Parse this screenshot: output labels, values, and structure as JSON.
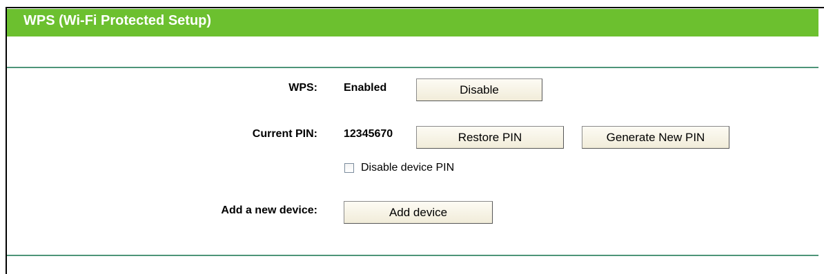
{
  "header": {
    "title": "WPS (Wi-Fi Protected Setup)"
  },
  "wps": {
    "label": "WPS:",
    "status": "Enabled",
    "toggle_button": "Disable"
  },
  "pin": {
    "label": "Current PIN:",
    "value": "12345670",
    "restore_button": "Restore PIN",
    "generate_button": "Generate New PIN",
    "disable_pin_checkbox_label": "Disable device PIN",
    "disable_pin_checked": false
  },
  "add_device": {
    "label": "Add a new device:",
    "button": "Add device"
  },
  "colors": {
    "title_bar": "#6cc02f",
    "divider": "#4d9478",
    "button_bg": "#f5f1e4"
  }
}
